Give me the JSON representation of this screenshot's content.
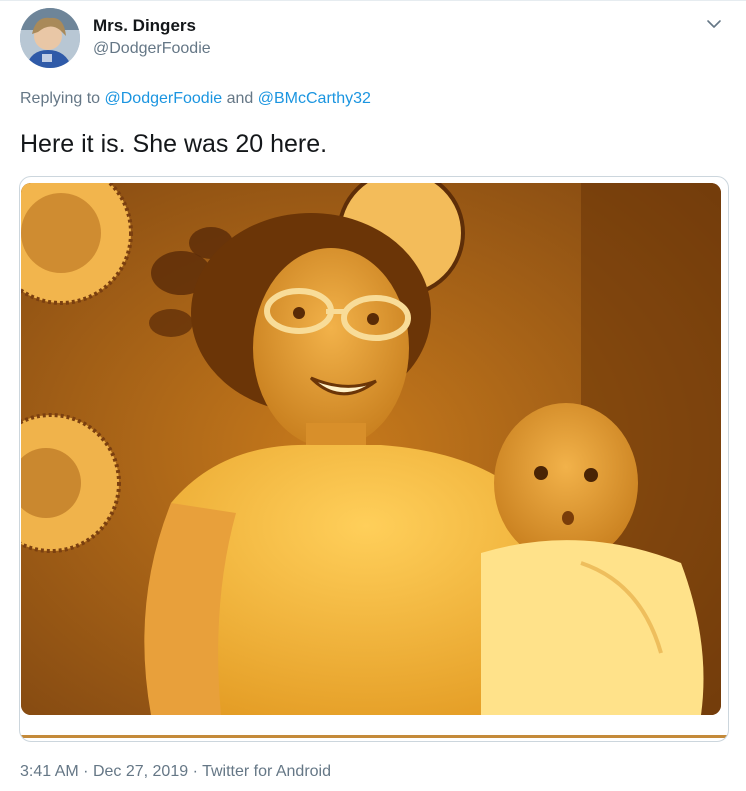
{
  "author": {
    "display_name": "Mrs. Dingers",
    "handle": "@DodgerFoodie",
    "avatar_icon": "user-avatar"
  },
  "reply": {
    "prefix": "Replying to",
    "mention_1": "@DodgerFoodie",
    "conjunction": "and",
    "mention_2": "@BMcCarthy32"
  },
  "tweet": {
    "text": "Here it is. She was 20 here."
  },
  "meta": {
    "time": "3:41 AM",
    "separator_1": "·",
    "date": "Dec 27, 2019",
    "separator_2": "·",
    "source": "Twitter for Android"
  },
  "icons": {
    "menu": "chevron-down-icon"
  },
  "colors": {
    "link": "#1b95e0",
    "secondary_text": "#657786",
    "primary_text": "#14171a",
    "border": "#ccd6dd"
  }
}
